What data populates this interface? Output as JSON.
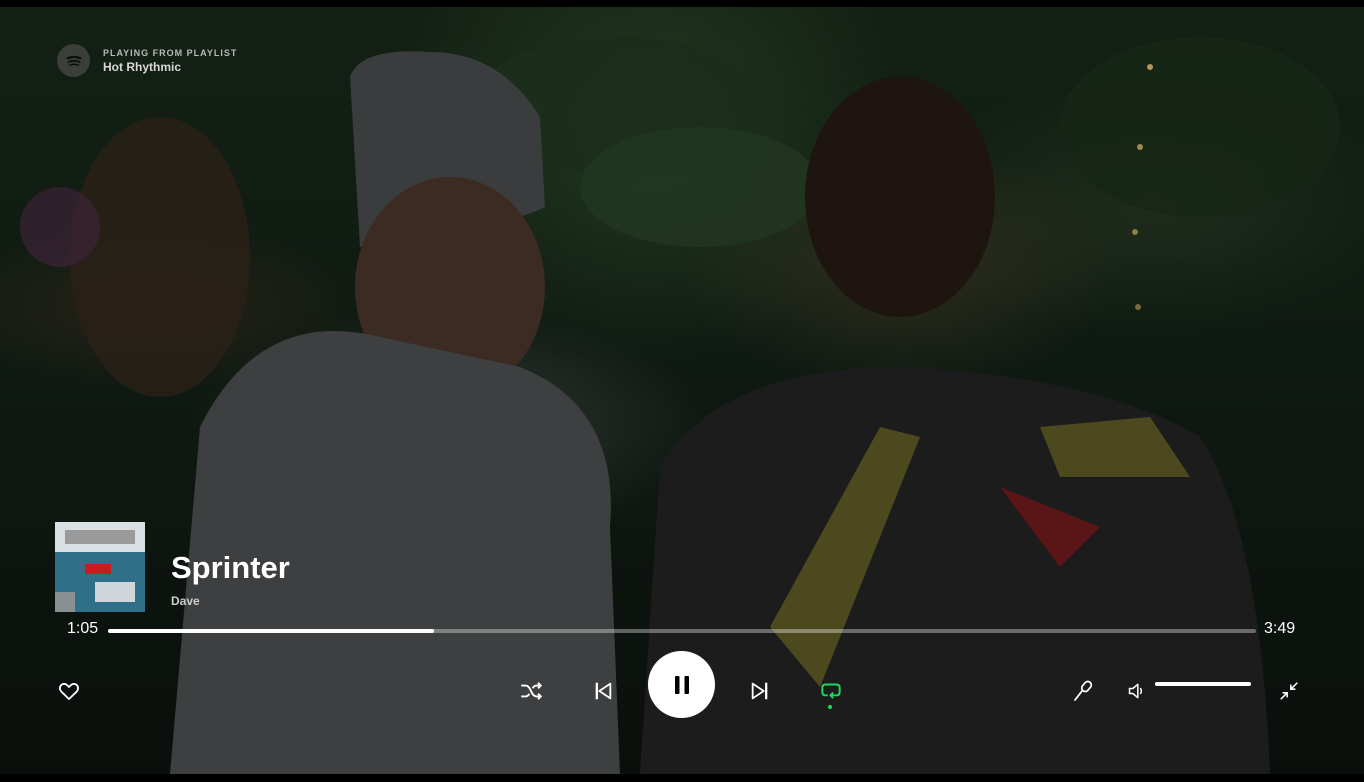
{
  "context": {
    "label": "PLAYING FROM PLAYLIST",
    "name": "Hot Rhythmic"
  },
  "track": {
    "title": "Sprinter",
    "artist": "Dave"
  },
  "playback": {
    "elapsed": "1:05",
    "duration": "3:49",
    "progress_fraction": 0.284,
    "repeat_active": true
  },
  "volume": {
    "level_fraction": 1.0
  },
  "colors": {
    "accent": "#1ed760",
    "text": "#ffffff"
  },
  "icons": {
    "logo": "spotify-logo",
    "like": "heart-icon",
    "shuffle": "shuffle-icon",
    "previous": "skip-back-icon",
    "play_pause": "pause-icon",
    "next": "skip-forward-icon",
    "repeat": "repeat-icon",
    "lyrics": "microphone-icon",
    "volume": "volume-icon",
    "fullscreen": "minimize-icon"
  }
}
